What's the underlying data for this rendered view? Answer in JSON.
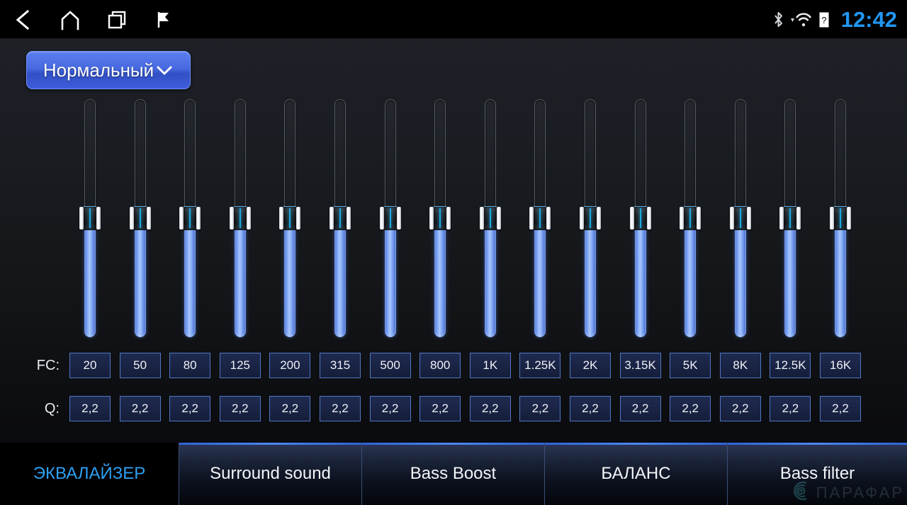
{
  "statusbar": {
    "nav": [
      {
        "name": "back-icon",
        "label": "Back"
      },
      {
        "name": "home-icon",
        "label": "Home"
      },
      {
        "name": "recents-icon",
        "label": "Recent apps"
      },
      {
        "name": "flag-icon",
        "label": "Flag"
      }
    ],
    "system": [
      {
        "name": "bluetooth-icon",
        "label": "Bluetooth"
      },
      {
        "name": "wifi-icon",
        "label": "Wi-Fi"
      },
      {
        "name": "sim-unknown-icon",
        "label": "SIM unknown"
      }
    ],
    "clock": "12:42",
    "clock_color": "#2196f3"
  },
  "preset": {
    "label": "Нормальный",
    "chevron": "chevron-down-icon",
    "accent": "#4869e0"
  },
  "equalizer": {
    "band_count": 16,
    "slider_value_percent": 50,
    "bands": [
      {
        "fc": "20",
        "q": "2,2",
        "value": 50
      },
      {
        "fc": "50",
        "q": "2,2",
        "value": 50
      },
      {
        "fc": "80",
        "q": "2,2",
        "value": 50
      },
      {
        "fc": "125",
        "q": "2,2",
        "value": 50
      },
      {
        "fc": "200",
        "q": "2,2",
        "value": 50
      },
      {
        "fc": "315",
        "q": "2,2",
        "value": 50
      },
      {
        "fc": "500",
        "q": "2,2",
        "value": 50
      },
      {
        "fc": "800",
        "q": "2,2",
        "value": 50
      },
      {
        "fc": "1K",
        "q": "2,2",
        "value": 50
      },
      {
        "fc": "1.25K",
        "q": "2,2",
        "value": 50
      },
      {
        "fc": "2K",
        "q": "2,2",
        "value": 50
      },
      {
        "fc": "3.15K",
        "q": "2,2",
        "value": 50
      },
      {
        "fc": "5K",
        "q": "2,2",
        "value": 50
      },
      {
        "fc": "8K",
        "q": "2,2",
        "value": 50
      },
      {
        "fc": "12.5K",
        "q": "2,2",
        "value": 50
      },
      {
        "fc": "16K",
        "q": "2,2",
        "value": 50
      }
    ],
    "fc_label": "FC:",
    "q_label": "Q:"
  },
  "tabs": [
    {
      "label": "ЭКВАЛАЙЗЕР",
      "active": true,
      "name": "tab-equalizer"
    },
    {
      "label": "Surround sound",
      "active": false,
      "name": "tab-surround-sound"
    },
    {
      "label": "Bass Boost",
      "active": false,
      "name": "tab-bass-boost"
    },
    {
      "label": "БАЛАНС",
      "active": false,
      "name": "tab-balance"
    },
    {
      "label": "Bass filter",
      "active": false,
      "name": "tab-bass-filter"
    }
  ],
  "watermark": {
    "text": "ПАРАФАР",
    "logo": "target-circle-icon",
    "color": "#2f6f76"
  }
}
